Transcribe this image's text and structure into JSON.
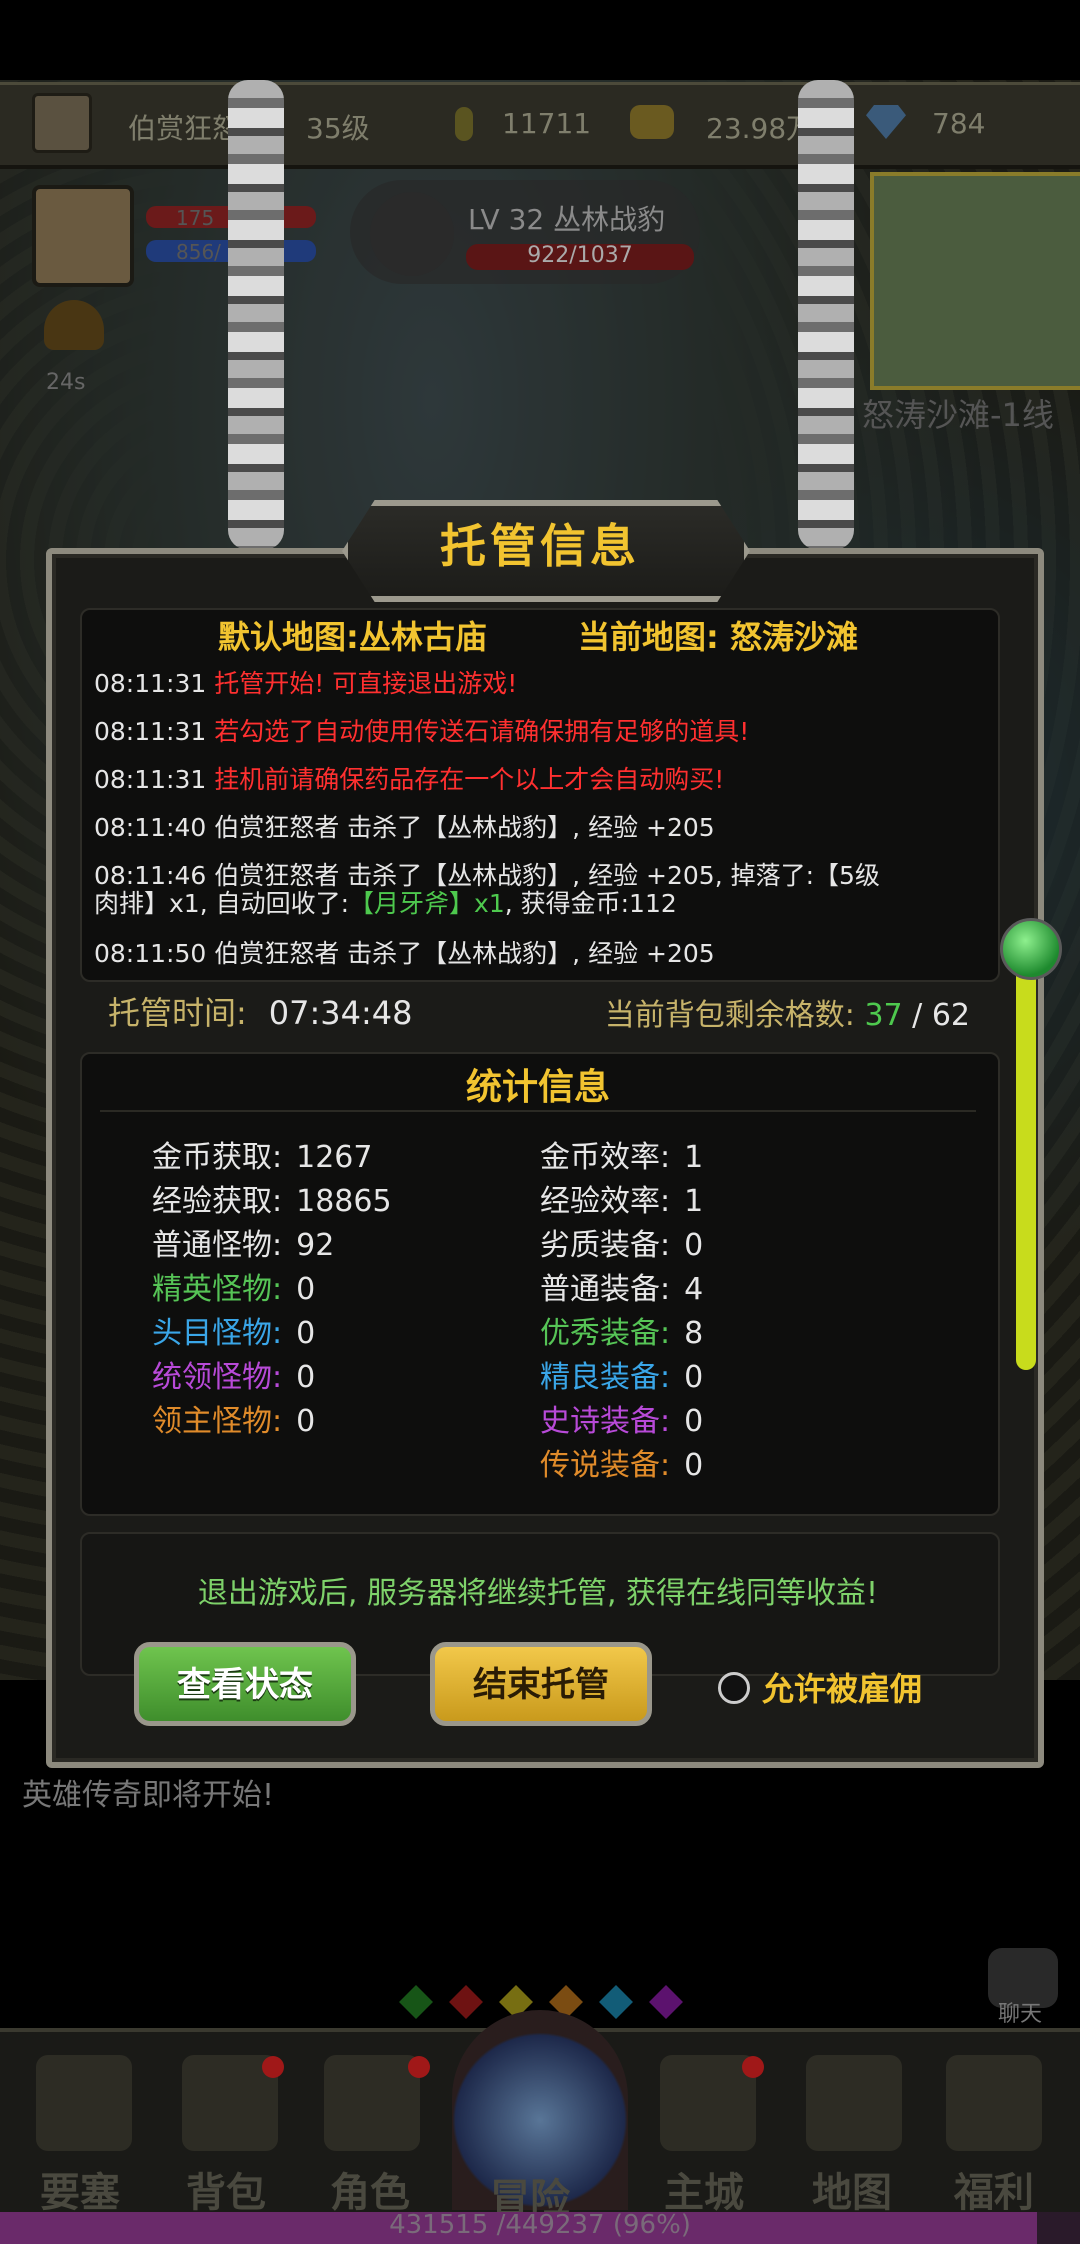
{
  "status_bar": {
    "player_name": "伯赏狂怒",
    "level": "35级",
    "power": "11711",
    "gold": "23.98万",
    "diamonds": "784"
  },
  "player": {
    "hp": "175",
    "mp": "856/"
  },
  "enemy": {
    "name": "LV 32 丛林战豹",
    "hp_text": "922/1037"
  },
  "map_label": "怒涛沙滩-1线",
  "timer": "24s",
  "dialog": {
    "title": "托管信息",
    "default_map": "默认地图:丛林古庙",
    "current_map": "当前地图: 怒涛沙滩",
    "log": [
      {
        "time": "08:11:31",
        "text": "托管开始! 可直接退出游戏!"
      },
      {
        "time": "08:11:31",
        "text": "若勾选了自动使用传送石请确保拥有足够的道具!"
      },
      {
        "time": "08:11:31",
        "text": "挂机前请确保药品存在一个以上才会自动购买!"
      },
      {
        "time": "08:11:40",
        "text": "伯赏狂怒者 击杀了【丛林战豹】, 经验 +205"
      },
      {
        "time": "08:11:46",
        "text_a": "伯赏狂怒者 击杀了【丛林战豹】, 经验 +205, 掉落了:【5级",
        "text_b": "肉排】x1, 自动回收了:",
        "text_c": "【月牙斧】x1",
        "text_d": ", 获得金币:112"
      },
      {
        "time": "08:11:50",
        "text": "伯赏狂怒者 击杀了【丛林战豹】, 经验 +205"
      }
    ],
    "hosting_label": "托管时间:",
    "hosting_time": "07:34:48",
    "bag_label": "当前背包剩余格数:",
    "bag_current": "37",
    "bag_sep": " / ",
    "bag_total": "62",
    "stats_title": "统计信息",
    "stats_left": [
      {
        "label": "金币获取:",
        "value": "1267"
      },
      {
        "label": "经验获取:",
        "value": "18865"
      },
      {
        "label": "普通怪物:",
        "value": "92"
      },
      {
        "label": "精英怪物:",
        "value": "0"
      },
      {
        "label": "头目怪物:",
        "value": "0"
      },
      {
        "label": "统领怪物:",
        "value": "0"
      },
      {
        "label": "领主怪物:",
        "value": "0"
      }
    ],
    "stats_right": [
      {
        "label": "金币效率:",
        "value": "1"
      },
      {
        "label": "经验效率:",
        "value": "1"
      },
      {
        "label": "劣质装备:",
        "value": "0"
      },
      {
        "label": "普通装备:",
        "value": "4"
      },
      {
        "label": "优秀装备:",
        "value": "8"
      },
      {
        "label": "精良装备:",
        "value": "0"
      },
      {
        "label": "史诗装备:",
        "value": "0"
      },
      {
        "label": "传说装备:",
        "value": "0"
      }
    ],
    "notice": "退出游戏后, 服务器将继续托管, 获得在线同等收益!",
    "btn_status": "查看状态",
    "btn_end": "结束托管",
    "hire_label": "允许被雇佣"
  },
  "chat_message": "英雄传奇即将开始!",
  "chat_label": "聊天",
  "nav": [
    "要塞",
    "背包",
    "角色",
    "冒险",
    "主城",
    "地图",
    "福利"
  ],
  "exp_text": "431515 /449237 (96%)",
  "exp_progress": 0.96,
  "colors": {
    "gold": "#f2c430",
    "red": "#ff3030",
    "green": "#4ec94e"
  }
}
